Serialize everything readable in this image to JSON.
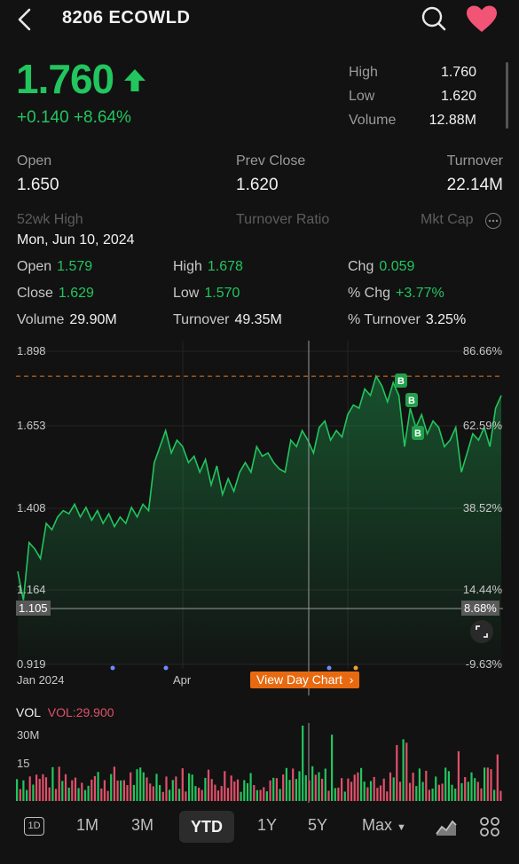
{
  "header": {
    "title": "8206  ECOWLD"
  },
  "quote": {
    "price": "1.760",
    "change": "+0.140  +8.64%",
    "high_label": "High",
    "high": "1.760",
    "low_label": "Low",
    "low": "1.620",
    "volume_label": "Volume",
    "volume": "12.88M"
  },
  "stats": {
    "open_label": "Open",
    "open": "1.650",
    "prev_close_label": "Prev Close",
    "prev_close": "1.620",
    "turnover_label": "Turnover",
    "turnover": "22.14M",
    "wk52_label": "52wk High",
    "turnover_ratio_label": "Turnover Ratio",
    "mkt_cap_label": "Mkt Cap"
  },
  "tooltip": {
    "date": "Mon, Jun 10, 2024",
    "open_label": "Open",
    "open": "1.579",
    "high_label": "High",
    "high": "1.678",
    "chg_label": "Chg",
    "chg": "0.059",
    "close_label": "Close",
    "close": "1.629",
    "low_label": "Low",
    "low": "1.570",
    "pchg_label": "% Chg",
    "pchg": "+3.77%",
    "volume_label": "Volume",
    "volume": "29.90M",
    "turnover_label": "Turnover",
    "turnover": "49.35M",
    "pturnover_label": "% Turnover",
    "pturnover": "3.25%"
  },
  "chart": {
    "y_left": [
      "1.898",
      "1.653",
      "1.408",
      "1.164",
      "0.919"
    ],
    "y_right": [
      "86.66%",
      "62.59%",
      "38.52%",
      "14.44%",
      "-9.63%"
    ],
    "x_labels": [
      "Jan 2024",
      "Apr"
    ],
    "crosshair_price": "1.105",
    "crosshair_pct": "8.68%",
    "view_day_label": "View Day Chart",
    "marker_label": "B",
    "line_color": "#22c55e",
    "dashed_color": "#e8791f"
  },
  "volume": {
    "title": "VOL",
    "value_label": "VOL:29.900",
    "y_labels": [
      "30M",
      "15"
    ],
    "up_color": "#22c55e",
    "down_color": "#e0506a"
  },
  "tabs": {
    "d1": "1D",
    "m1": "1M",
    "m3": "3M",
    "ytd": "YTD",
    "y1": "1Y",
    "y5": "5Y",
    "max": "Max"
  },
  "chart_data": {
    "type": "line",
    "title": "",
    "ylim": [
      0.919,
      1.898
    ],
    "x": [
      "Jan 2024",
      "Apr"
    ],
    "series": [
      {
        "values": [
          1.21,
          1.12,
          1.3,
          1.28,
          1.25,
          1.36,
          1.34,
          1.38,
          1.4,
          1.39,
          1.42,
          1.38,
          1.41,
          1.37,
          1.4,
          1.36,
          1.39,
          1.35,
          1.38,
          1.36,
          1.41,
          1.38,
          1.42,
          1.4,
          1.55,
          1.6,
          1.65,
          1.58,
          1.62,
          1.6,
          1.55,
          1.57,
          1.52,
          1.56,
          1.48,
          1.54,
          1.45,
          1.5,
          1.46,
          1.52,
          1.55,
          1.52,
          1.6,
          1.57,
          1.58,
          1.55,
          1.53,
          1.52,
          1.62,
          1.6,
          1.65,
          1.62,
          1.58,
          1.66,
          1.68,
          1.62,
          1.65,
          1.63,
          1.7,
          1.73,
          1.72,
          1.78,
          1.76,
          1.82,
          1.79,
          1.74,
          1.8,
          1.76,
          1.6,
          1.72,
          1.66,
          1.7,
          1.64,
          1.68,
          1.66,
          1.6,
          1.62,
          1.66,
          1.52,
          1.58,
          1.64,
          1.62,
          1.66,
          1.6,
          1.72,
          1.76
        ]
      }
    ]
  }
}
